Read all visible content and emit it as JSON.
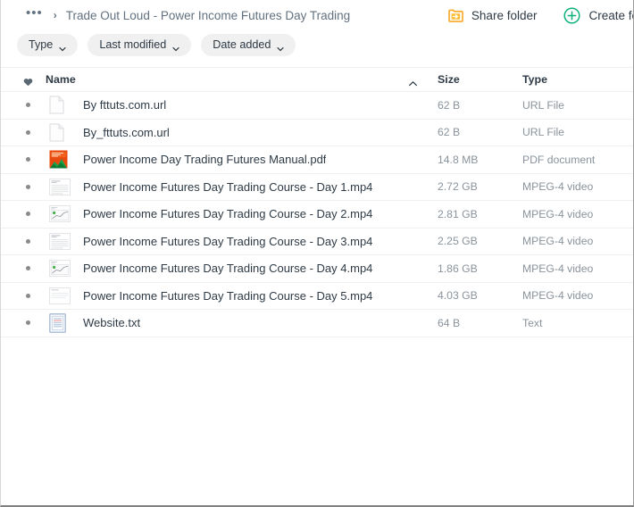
{
  "breadcrumb": {
    "overflow_label": "•••",
    "separator": "›",
    "current_folder": "Trade Out Loud - Power Income Futures Day Trading"
  },
  "toolbar": {
    "share_folder_label": "Share folder",
    "share_folder_icon": "share-folder-icon",
    "create_folder_label": "Create fo",
    "create_folder_icon": "plus-circle-icon",
    "accent_orange": "#f9a825",
    "accent_green": "#0bb07b"
  },
  "filters": [
    {
      "label": "Type",
      "icon": "chevron-down-icon"
    },
    {
      "label": "Last modified",
      "icon": "chevron-down-icon"
    },
    {
      "label": "Date added",
      "icon": "chevron-down-icon"
    }
  ],
  "table": {
    "headers": {
      "favorite_icon": "heart-icon",
      "name": "Name",
      "sort_icon": "chevron-up-icon",
      "size": "Size",
      "type": "Type"
    },
    "rows": [
      {
        "name": "By fttuts.com.url",
        "size": "62 B",
        "type": "URL File",
        "icon": "blank-page-icon"
      },
      {
        "name": "By_fttuts.com.url",
        "size": "62 B",
        "type": "URL File",
        "icon": "blank-page-icon"
      },
      {
        "name": "Power Income Day Trading Futures Manual.pdf",
        "size": "14.8 MB",
        "type": "PDF document",
        "icon": "pdf-thumbnail-icon"
      },
      {
        "name": "Power Income Futures Day Trading Course - Day 1.mp4",
        "size": "2.72 GB",
        "type": "MPEG-4 video",
        "icon": "video-thumbnail-text-icon"
      },
      {
        "name": "Power Income Futures Day Trading Course - Day 2.mp4",
        "size": "2.81 GB",
        "type": "MPEG-4 video",
        "icon": "video-thumbnail-chart-icon"
      },
      {
        "name": "Power Income Futures Day Trading Course - Day 3.mp4",
        "size": "2.25 GB",
        "type": "MPEG-4 video",
        "icon": "video-thumbnail-text-icon"
      },
      {
        "name": "Power Income Futures Day Trading Course - Day 4.mp4",
        "size": "1.86 GB",
        "type": "MPEG-4 video",
        "icon": "video-thumbnail-chart-icon"
      },
      {
        "name": "Power Income Futures Day Trading Course - Day 5.mp4",
        "size": "4.03 GB",
        "type": "MPEG-4 video",
        "icon": "video-thumbnail-text-icon"
      },
      {
        "name": "Website.txt",
        "size": "64 B",
        "type": "Text",
        "icon": "text-document-icon"
      }
    ]
  }
}
